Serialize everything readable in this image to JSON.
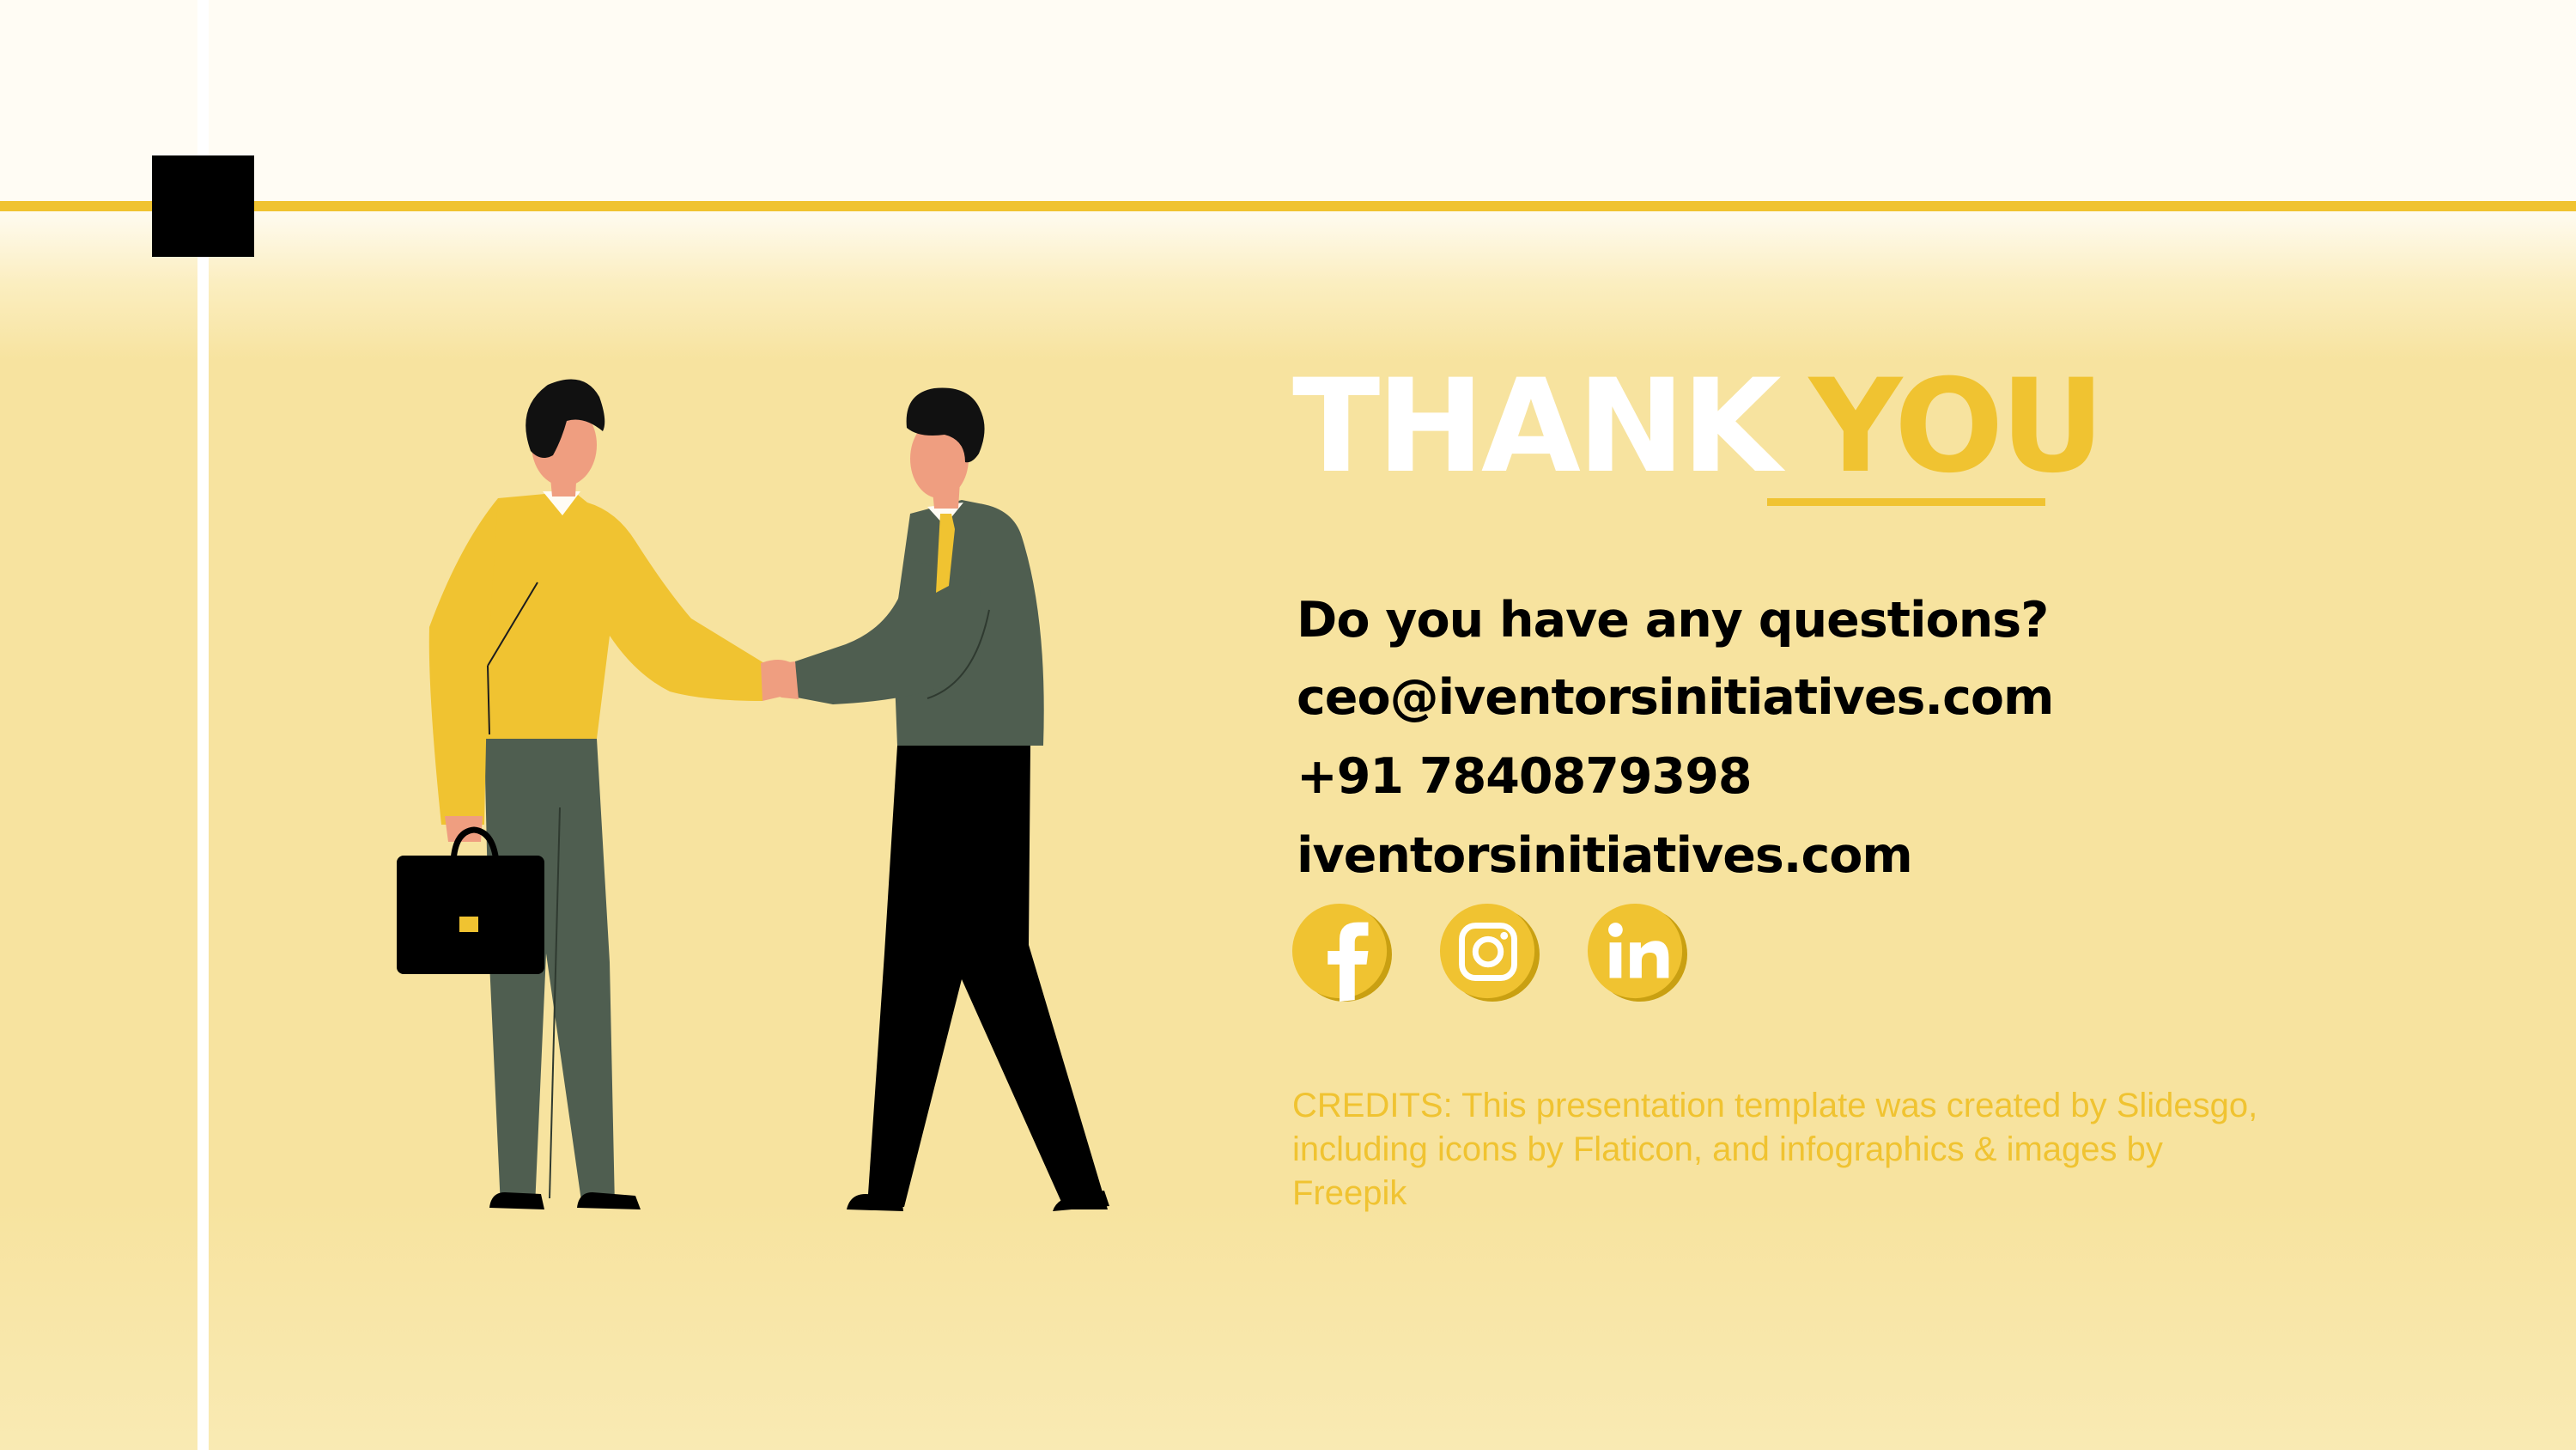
{
  "colors": {
    "accent": "#f0c331",
    "background": "#f7e39f",
    "text": "#000000",
    "title_light": "#ffffff"
  },
  "title": {
    "word1": "THANK",
    "word2": "YOU"
  },
  "contact": {
    "question": "Do you have any questions?",
    "email": "ceo@iventorsinitiatives.com",
    "phone": "+91 7840879398",
    "website": "iventorsinitiatives.com"
  },
  "social": [
    {
      "icon": "facebook-icon"
    },
    {
      "icon": "instagram-icon"
    },
    {
      "icon": "linkedin-icon"
    }
  ],
  "credits": {
    "line1": "CREDITS: This presentation template was created by Slidesgo,",
    "line2": "including icons by Flaticon, and infographics & images by",
    "line3": "Freepik"
  },
  "illustration": {
    "subject": "two-businessmen-handshake"
  }
}
